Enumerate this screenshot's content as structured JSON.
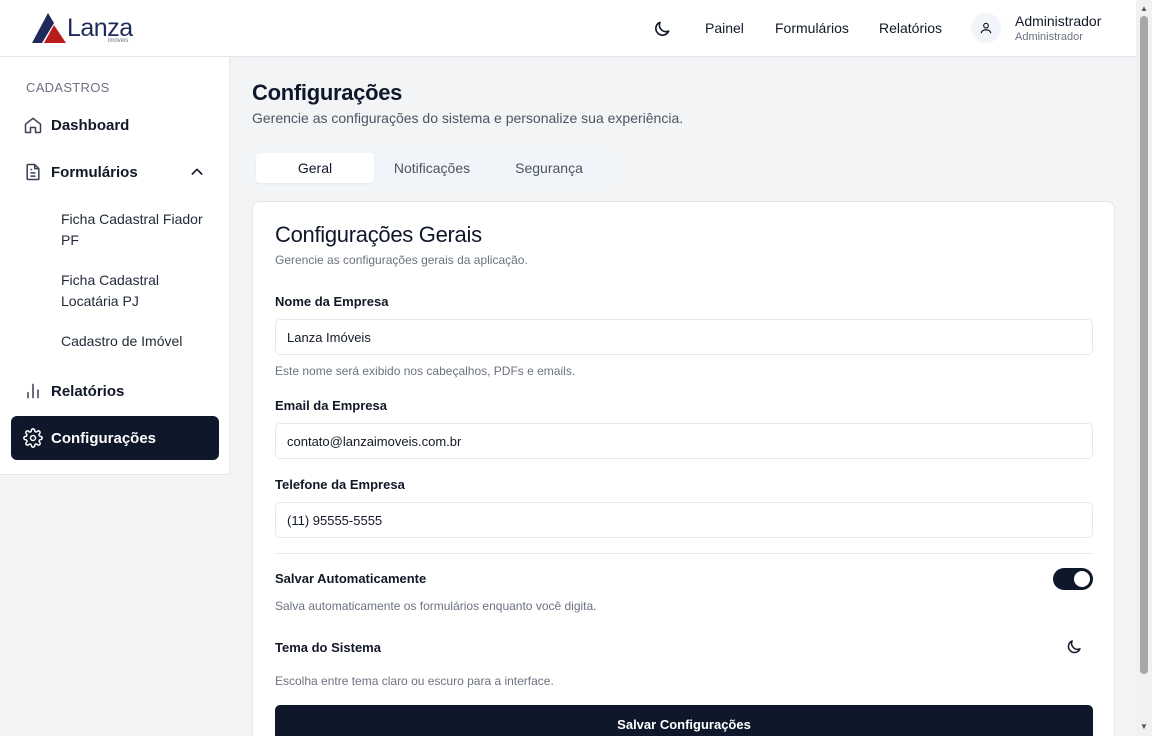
{
  "brand": {
    "name": "Lanza",
    "tagline": "imóveis",
    "colors": {
      "blue": "#1e2a5a",
      "red": "#b91c1c"
    }
  },
  "header": {
    "nav": [
      {
        "label": "Painel"
      },
      {
        "label": "Formulários"
      },
      {
        "label": "Relatórios"
      }
    ],
    "user": {
      "name": "Administrador",
      "role": "Administrador"
    }
  },
  "sidebar": {
    "section_label": "CADASTROS",
    "items": {
      "dashboard": "Dashboard",
      "formularios": "Formulários",
      "relatorios": "Relatórios",
      "configuracoes": "Configurações"
    },
    "sub_items": [
      "Ficha Cadastral Fiador PF",
      "Ficha Cadastral Locatária PJ",
      "Cadastro de Imóvel"
    ]
  },
  "main": {
    "title": "Configurações",
    "subtitle": "Gerencie as configurações do sistema e personalize sua experiência.",
    "tabs": [
      {
        "label": "Geral",
        "active": true
      },
      {
        "label": "Notificações"
      },
      {
        "label": "Segurança"
      }
    ],
    "card": {
      "title": "Configurações Gerais",
      "subtitle": "Gerencie as configurações gerais da aplicação.",
      "company_name": {
        "label": "Nome da Empresa",
        "value": "Lanza Imóveis",
        "help": "Este nome será exibido nos cabeçalhos, PDFs e emails."
      },
      "company_email": {
        "label": "Email da Empresa",
        "value": "contato@lanzaimoveis.com.br"
      },
      "company_phone": {
        "label": "Telefone da Empresa",
        "value": "(11) 95555-5555"
      },
      "autosave": {
        "label": "Salvar Automaticamente",
        "help": "Salva automaticamente os formulários enquanto você digita.",
        "enabled": true
      },
      "theme": {
        "label": "Tema do Sistema",
        "help": "Escolha entre tema claro ou escuro para a interface."
      },
      "save_button": "Salvar Configurações"
    }
  },
  "icons": [
    "moon-icon",
    "user-icon",
    "home-icon",
    "file-text-icon",
    "chevron-up-icon",
    "bar-chart-icon",
    "gear-icon"
  ],
  "colors": {
    "primary": "#0f172a",
    "background": "#f3f4f6",
    "muted": "#6b7280"
  }
}
